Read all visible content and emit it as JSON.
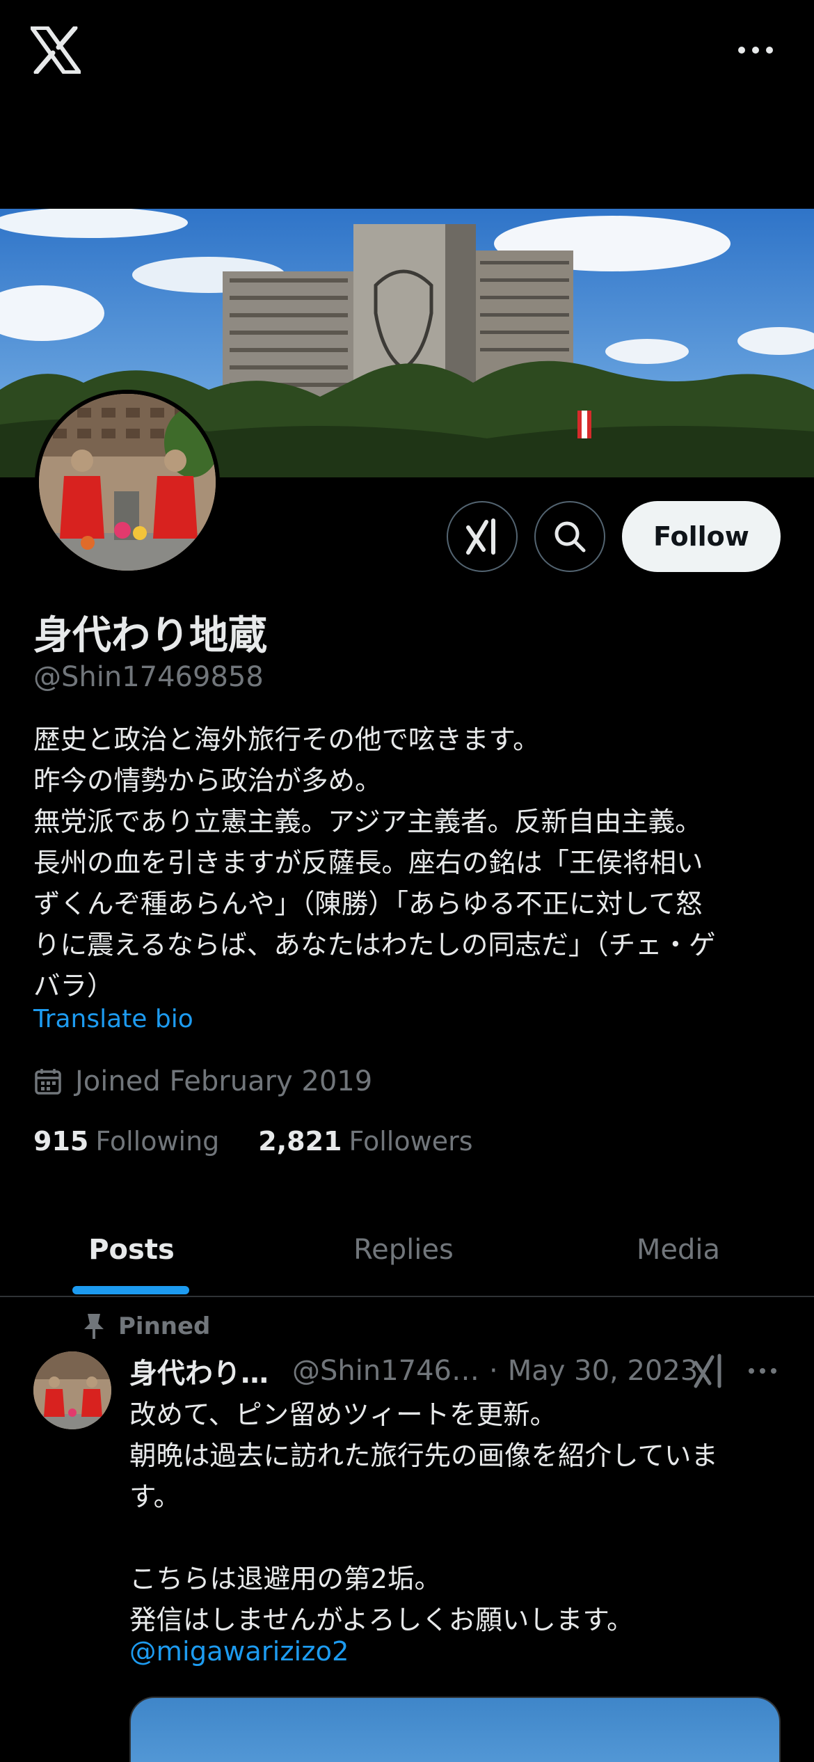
{
  "top_bar": {
    "logo": "x-logo-icon",
    "more": "more-horizontal-icon"
  },
  "profile": {
    "display_name": "身代わり地蔵",
    "handle": "@Shin17469858",
    "bio_lines": [
      "歴史と政治と海外旅行その他で呟きます。",
      "昨今の情勢から政治が多め。",
      "無党派であり立憲主義。アジア主義者。反新自由主義。",
      "長州の血を引きますが反薩長。座右の銘は「王侯将相い",
      "ずくんぞ種あらんや」（陳勝）「あらゆる不正に対して怒",
      "りに震えるならば、あなたはわたしの同志だ」（チェ・ゲ",
      "バラ）"
    ],
    "translate_label": "Translate bio",
    "joined": "Joined February 2019",
    "following_count": "915",
    "following_label": "Following",
    "followers_count": "2,821",
    "followers_label": "Followers"
  },
  "actions": {
    "grok_icon": "grok-icon",
    "search_icon": "search-icon",
    "follow_label": "Follow"
  },
  "tabs": [
    {
      "label": "Posts",
      "active": true
    },
    {
      "label": "Replies",
      "active": false
    },
    {
      "label": "Media",
      "active": false
    }
  ],
  "pinned_post": {
    "pinned_label": "Pinned",
    "author_name": "身代わり…",
    "author_handle": "@Shin1746…",
    "date": "May 30, 2023",
    "separator": "·",
    "body_lines": [
      "改めて、ピン留めツィートを更新。",
      "朝晩は過去に訪れた旅行先の画像を紹介していま",
      "す。",
      "",
      "こちらは退避用の第2垢。",
      "発信はしませんがよろしくお願いします。"
    ],
    "mention": "@migawarizizo2"
  },
  "colors": {
    "accent": "#1d9bf0",
    "background": "#000000",
    "muted": "#71767b",
    "follow_bg": "#eff3f4"
  }
}
